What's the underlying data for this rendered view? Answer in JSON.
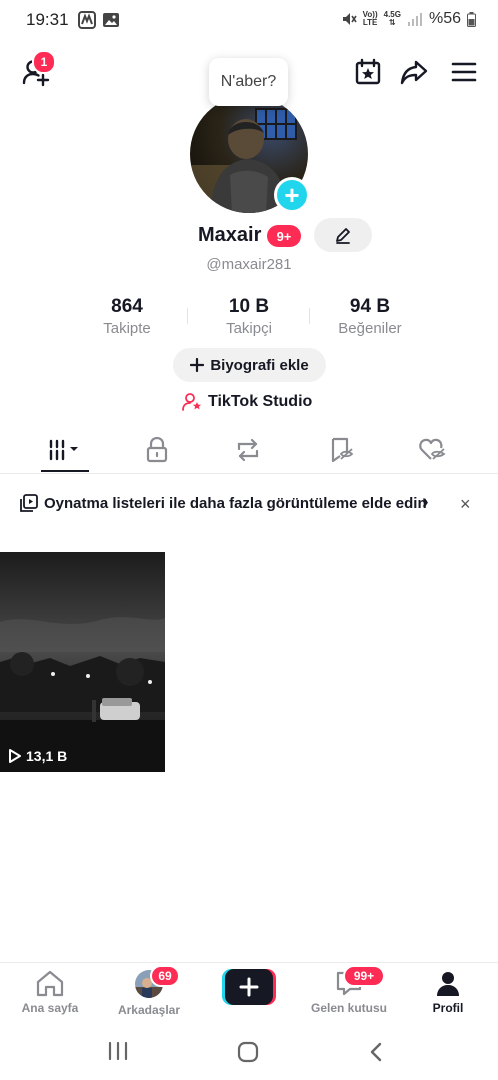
{
  "status_bar": {
    "time": "19:31",
    "battery": "%56",
    "net_top": "Vo))",
    "net_bottom": "LTE",
    "net_type": "4.5G"
  },
  "topbar": {
    "add_friends_badge": "1"
  },
  "profile": {
    "bubble_text": "N'aber?",
    "name": "Maxair",
    "name_badge": "9+",
    "handle": "@maxair281",
    "stats": [
      {
        "value": "864",
        "label": "Takipte"
      },
      {
        "value": "10 B",
        "label": "Takipçi"
      },
      {
        "value": "94 B",
        "label": "Beğeniler"
      }
    ],
    "bio_button": "Biyografi ekle",
    "studio_link": "TikTok Studio"
  },
  "banner": {
    "text": "Oynatma listeleri ile daha fazla görüntüleme elde edin",
    "arrow": "›",
    "close": "×"
  },
  "videos": [
    {
      "views": "13,1 B"
    }
  ],
  "bottom_nav": {
    "items": [
      {
        "label": "Ana sayfa"
      },
      {
        "label": "Arkadaşlar",
        "badge": "69"
      },
      {
        "label": "Gelen kutusu",
        "badge": "99+"
      },
      {
        "label": "Profil"
      }
    ],
    "create": "+"
  },
  "colors": {
    "accent": "#fe2c55",
    "cyan": "#20d5ec",
    "text": "#161823",
    "muted": "#8a8b91"
  }
}
